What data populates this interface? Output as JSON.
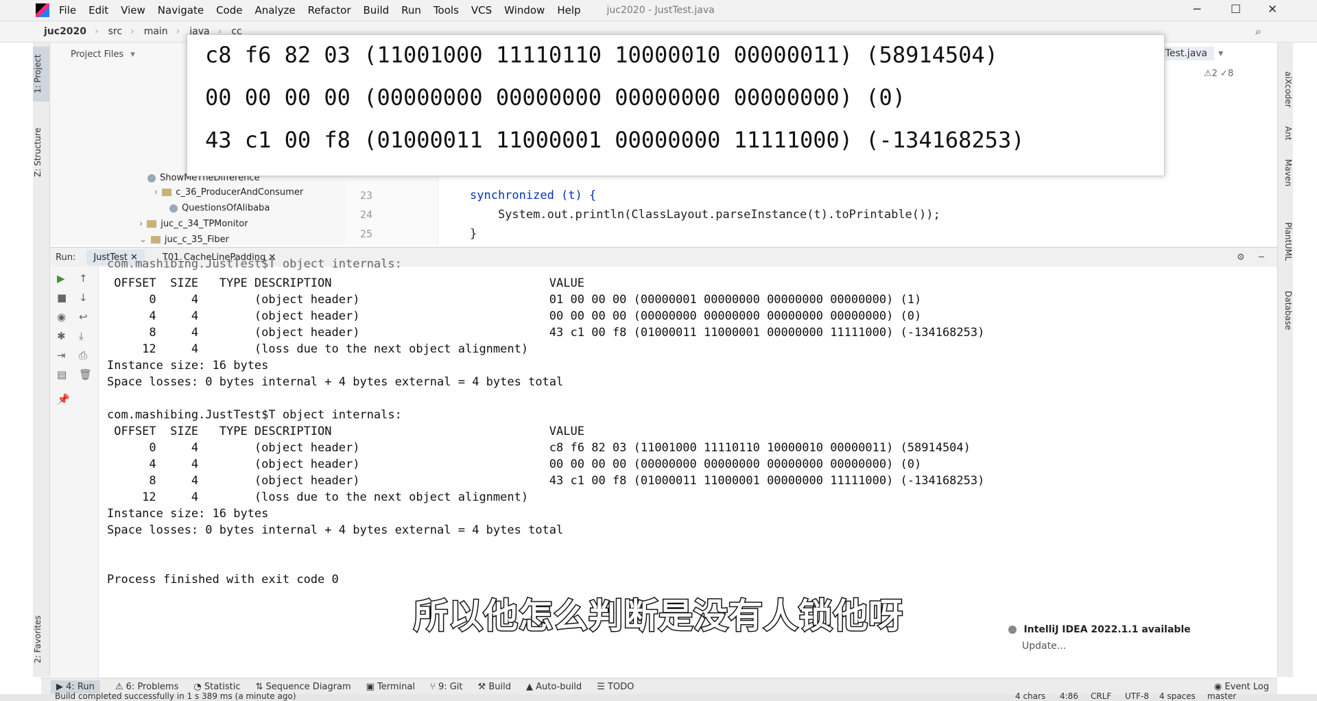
{
  "menubar": {
    "items": [
      "File",
      "Edit",
      "View",
      "Navigate",
      "Code",
      "Analyze",
      "Refactor",
      "Build",
      "Run",
      "Tools",
      "VCS",
      "Window",
      "Help"
    ],
    "title": "juc2020 - JustTest.java"
  },
  "navbar": {
    "crumbs": [
      "juc2020",
      "src",
      "main",
      "java",
      "cc"
    ]
  },
  "left_tabs": {
    "project": "1: Project",
    "structure": "Z: Structure",
    "favorites": "2: Favorites"
  },
  "right_tabs": [
    "aiXcoder",
    "Ant",
    "Maven",
    "PlantUML",
    "Database"
  ],
  "project_panel": {
    "header": "Project Files",
    "items": [
      "ShowMeTheDifference",
      "c_36_ProducerAndConsumer",
      "QuestionsOfAlibaba",
      "juc_c_34_TPMonitor",
      "juc_c_35_Fiber"
    ]
  },
  "editor": {
    "line_numbers": [
      "23",
      "24",
      "25"
    ],
    "code": [
      "synchronized (t) {",
      "    System.out.println(ClassLayout.parseInstance(t).toPrintable());",
      "}"
    ],
    "tab": "JustTest.java",
    "inspection": "⚠2 ✓8"
  },
  "overlay": {
    "lines": [
      "c8 f6 82 03 (11001000 11110110 10000010 00000011) (58914504)",
      "00 00 00 00 (00000000 00000000 00000000 00000000) (0)",
      "43 c1 00 f8 (01000011 11000001 00000000 11111000) (-134168253)"
    ]
  },
  "run_panel": {
    "label": "Run:",
    "tabs": [
      "JustTest",
      "T01_CacheLinePadding"
    ]
  },
  "console": {
    "top_partial": "com.mashibing.JustTest$T object internals:",
    "block1": {
      "header": " OFFSET  SIZE   TYPE DESCRIPTION                               VALUE",
      "rows": [
        "      0     4        (object header)                           01 00 00 00 (00000001 00000000 00000000 00000000) (1)",
        "      4     4        (object header)                           00 00 00 00 (00000000 00000000 00000000 00000000) (0)",
        "      8     4        (object header)                           43 c1 00 f8 (01000011 11000001 00000000 11111000) (-134168253)",
        "     12     4        (loss due to the next object alignment)"
      ],
      "size": "Instance size: 16 bytes",
      "losses": "Space losses: 0 bytes internal + 4 bytes external = 4 bytes total"
    },
    "block2": {
      "title": "com.mashibing.JustTest$T object internals:",
      "header": " OFFSET  SIZE   TYPE DESCRIPTION                               VALUE",
      "rows": [
        "      0     4        (object header)                           c8 f6 82 03 (11001000 11110110 10000010 00000011) (58914504)",
        "      4     4        (object header)                           00 00 00 00 (00000000 00000000 00000000 00000000) (0)",
        "      8     4        (object header)                           43 c1 00 f8 (01000011 11000001 00000000 11111000) (-134168253)",
        "     12     4        (loss due to the next object alignment)"
      ],
      "size": "Instance size: 16 bytes",
      "losses": "Space losses: 0 bytes internal + 4 bytes external = 4 bytes total"
    },
    "exit": "Process finished with exit code 0"
  },
  "subtitle": "所以他怎么判断是没有人锁他呀",
  "notification": {
    "title": "IntelliJ IDEA 2022.1.1 available",
    "action": "Update..."
  },
  "statusbar": {
    "items": [
      "4: Run",
      "6: Problems",
      "Statistic",
      "Sequence Diagram",
      "Terminal",
      "9: Git",
      "Build",
      "Auto-build",
      "TODO"
    ],
    "event_log": "Event Log"
  },
  "bottombar": {
    "message": "Build completed successfully in 1 s 389 ms (a minute ago)",
    "chars": "4 chars",
    "pos": "4:86",
    "eol": "CRLF",
    "enc": "UTF-8",
    "indent": "4 spaces",
    "branch": "master"
  }
}
